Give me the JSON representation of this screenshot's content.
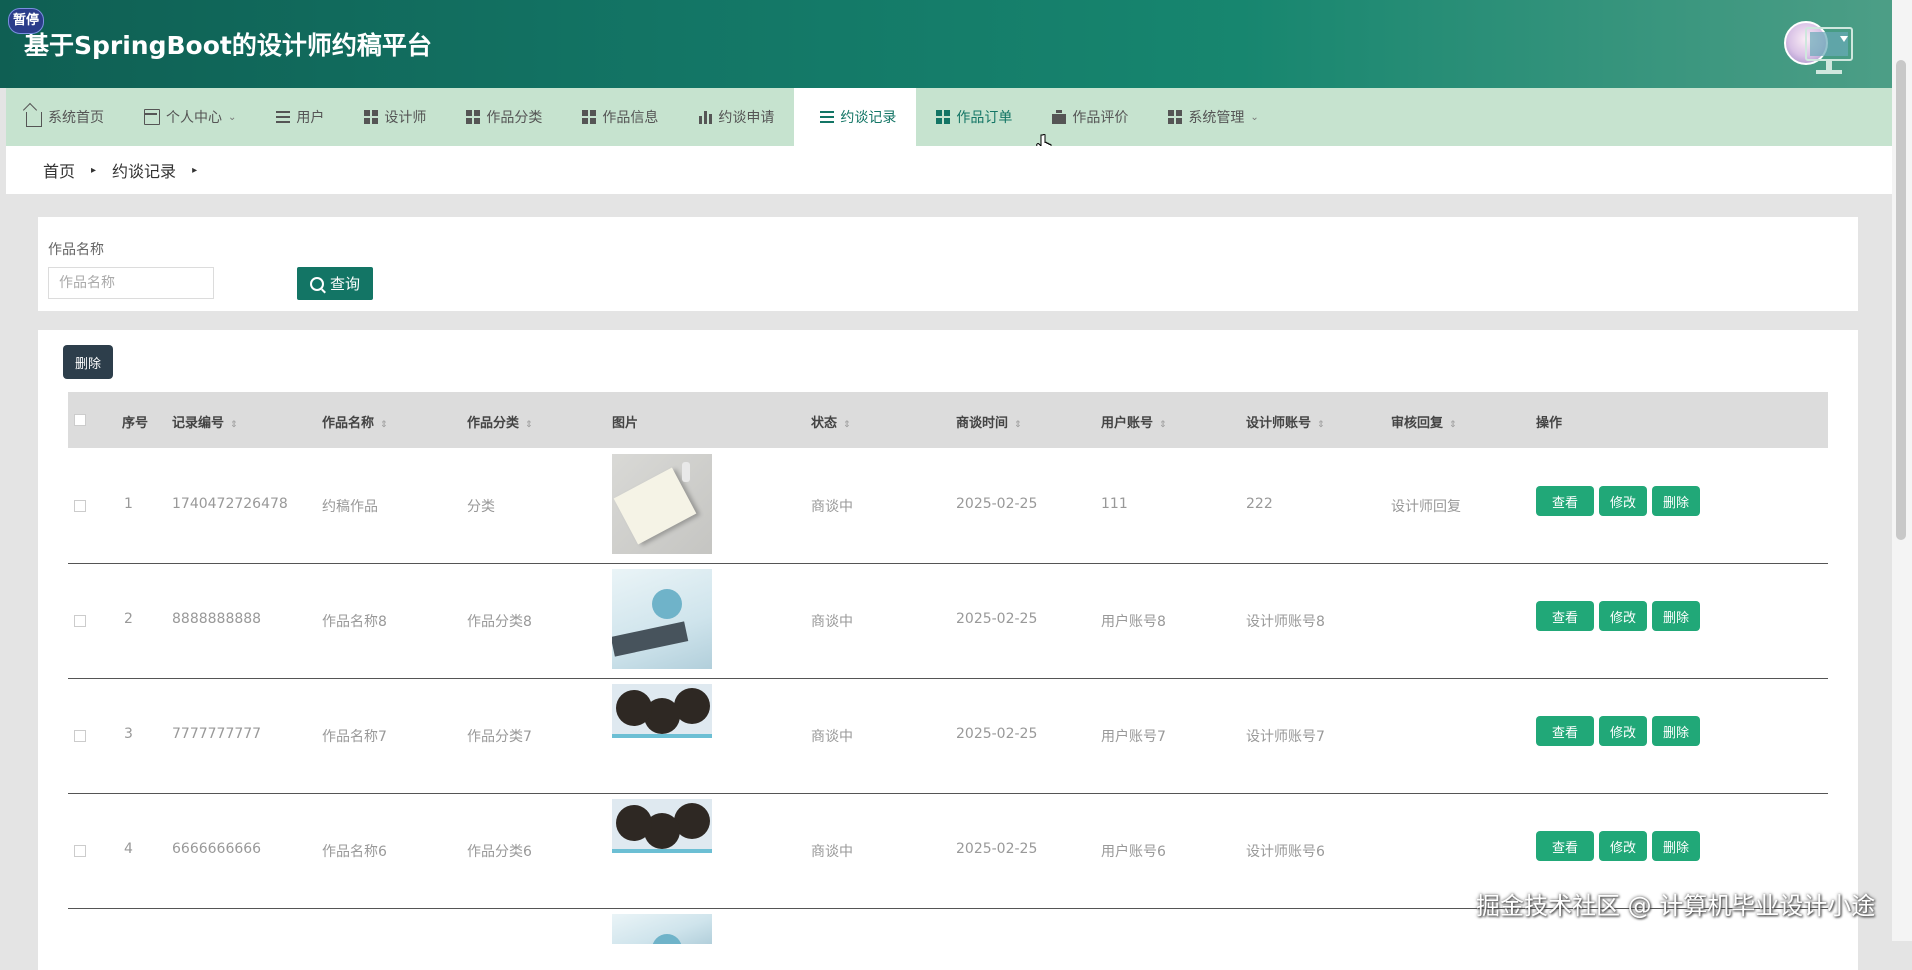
{
  "app": {
    "title": "基于SpringBoot的设计师约稿平台",
    "pause_badge": "暂停"
  },
  "nav": {
    "items": [
      {
        "label": "系统首页",
        "icon": "home-icon"
      },
      {
        "label": "个人中心",
        "icon": "card-icon",
        "caret": "⌄"
      },
      {
        "label": "用户",
        "icon": "list-icon"
      },
      {
        "label": "设计师",
        "icon": "grid-icon"
      },
      {
        "label": "作品分类",
        "icon": "grid-icon"
      },
      {
        "label": "作品信息",
        "icon": "grid-icon"
      },
      {
        "label": "约谈申请",
        "icon": "bar-chart-icon"
      },
      {
        "label": "约谈记录",
        "icon": "list-icon",
        "active": true
      },
      {
        "label": "作品订单",
        "icon": "grid-icon",
        "hover": true
      },
      {
        "label": "作品评价",
        "icon": "briefcase-icon"
      },
      {
        "label": "系统管理",
        "icon": "grid-icon",
        "caret": "⌄"
      }
    ]
  },
  "breadcrumb": {
    "home": "首页",
    "current": "约谈记录",
    "sep": "▸"
  },
  "search": {
    "label": "作品名称",
    "placeholder": "作品名称",
    "button": "查询"
  },
  "list": {
    "delete_button": "删除",
    "columns": {
      "index": "序号",
      "record_no": "记录编号",
      "work_name": "作品名称",
      "work_category": "作品分类",
      "image": "图片",
      "status": "状态",
      "meeting_time": "商谈时间",
      "user_account": "用户账号",
      "designer_account": "设计师账号",
      "review_reply": "审核回复",
      "actions": "操作"
    },
    "sort_glyph": "⇕",
    "rows": [
      {
        "index": "1",
        "record_no": "1740472726478",
        "work_name": "约稿作品",
        "work_category": "分类",
        "image": "notebook-photo",
        "status": "商谈中",
        "meeting_time": "2025-02-25",
        "user_account": "111",
        "designer_account": "222",
        "review_reply": "设计师回复"
      },
      {
        "index": "2",
        "record_no": "8888888888",
        "work_name": "作品名称8",
        "work_category": "作品分类8",
        "image": "lab-photo",
        "status": "商谈中",
        "meeting_time": "2025-02-25",
        "user_account": "用户账号8",
        "designer_account": "设计师账号8",
        "review_reply": ""
      },
      {
        "index": "3",
        "record_no": "7777777777",
        "work_name": "作品名称7",
        "work_category": "作品分类7",
        "image": "scientists-illustration",
        "status": "商谈中",
        "meeting_time": "2025-02-25",
        "user_account": "用户账号7",
        "designer_account": "设计师账号7",
        "review_reply": ""
      },
      {
        "index": "4",
        "record_no": "6666666666",
        "work_name": "作品名称6",
        "work_category": "作品分类6",
        "image": "scientists-illustration",
        "status": "商谈中",
        "meeting_time": "2025-02-25",
        "user_account": "用户账号6",
        "designer_account": "设计师账号6",
        "review_reply": ""
      }
    ],
    "row_actions": {
      "view": "查看",
      "edit": "修改",
      "delete": "删除"
    }
  },
  "watermark": "掘金技术社区 @ 计算机毕业设计小途",
  "colors": {
    "header_start": "#0f5f53",
    "nav_bg": "#c6e3cf",
    "primary": "#137565",
    "action_green": "#21a878",
    "dark_button": "#2d3e4b"
  }
}
